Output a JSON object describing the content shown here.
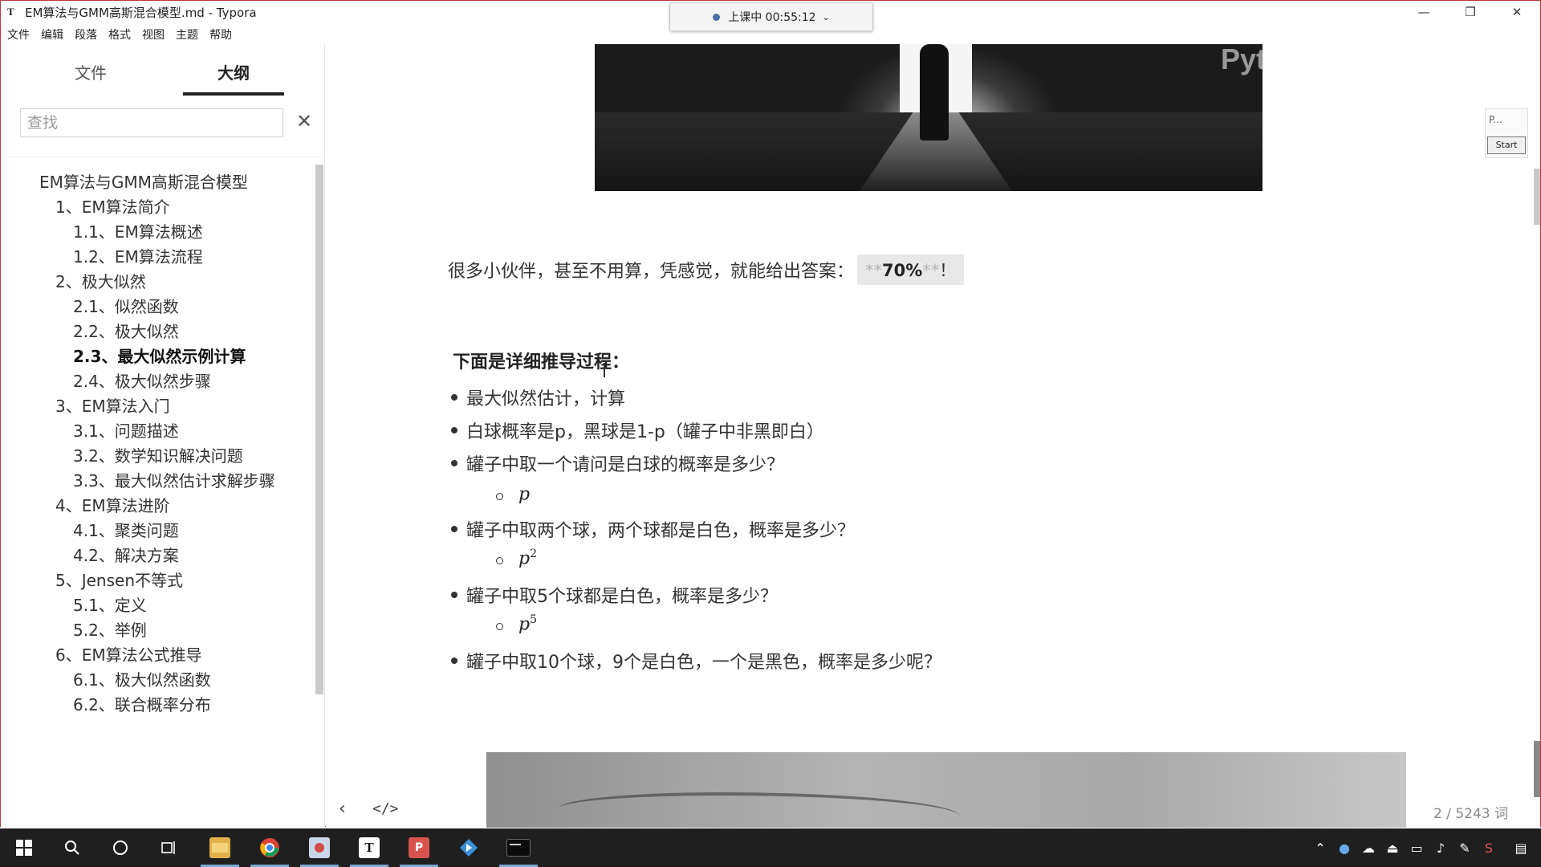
{
  "window": {
    "app_icon": "T",
    "title": "EM算法与GMM高斯混合模型.md - Typora",
    "controls": {
      "minimize": "—",
      "maximize": "❐",
      "close": "✕"
    }
  },
  "timer": {
    "label": "上课中 00:55:12",
    "chevron": "⌄"
  },
  "menu": [
    "文件",
    "编辑",
    "段落",
    "格式",
    "视图",
    "主题",
    "帮助"
  ],
  "sidebar": {
    "tabs": {
      "files": "文件",
      "outline": "大纲"
    },
    "search_placeholder": "查找",
    "close_glyph": "✕",
    "outline": [
      {
        "level": 1,
        "label": "EM算法与GMM高斯混合模型"
      },
      {
        "level": 2,
        "label": "1、EM算法简介"
      },
      {
        "level": 3,
        "label": "1.1、EM算法概述"
      },
      {
        "level": 3,
        "label": "1.2、EM算法流程"
      },
      {
        "level": 2,
        "label": "2、极大似然"
      },
      {
        "level": 3,
        "label": "2.1、似然函数"
      },
      {
        "level": 3,
        "label": "2.2、极大似然"
      },
      {
        "level": 3,
        "label": "2.3、最大似然示例计算",
        "active": true
      },
      {
        "level": 3,
        "label": "2.4、极大似然步骤"
      },
      {
        "level": 2,
        "label": "3、EM算法入门"
      },
      {
        "level": 3,
        "label": "3.1、问题描述"
      },
      {
        "level": 3,
        "label": "3.2、数学知识解决问题"
      },
      {
        "level": 3,
        "label": "3.3、最大似然估计求解步骤"
      },
      {
        "level": 2,
        "label": "4、EM算法进阶"
      },
      {
        "level": 3,
        "label": "4.1、聚类问题"
      },
      {
        "level": 3,
        "label": "4.2、解决方案"
      },
      {
        "level": 2,
        "label": "5、Jensen不等式"
      },
      {
        "level": 3,
        "label": "5.1、定义"
      },
      {
        "level": 3,
        "label": "5.2、举例"
      },
      {
        "level": 2,
        "label": "6、EM算法公式推导"
      },
      {
        "level": 3,
        "label": "6.1、极大似然函数"
      },
      {
        "level": 3,
        "label": "6.2、联合概率分布"
      }
    ]
  },
  "content": {
    "watermark": "Pyt bilibili",
    "paragraph": "很多小伙伴，甚至不用算，凭感觉，就能给出答案：",
    "answer_prefix": "**",
    "answer": "70%",
    "answer_suffix": "**",
    "answer_end": "！",
    "heading": "下面是详细推导过程：",
    "items": [
      {
        "text": "最大似然估计，计算"
      },
      {
        "text": "白球概率是p，黑球是1-p（罐子中非黑即白）"
      },
      {
        "text": "罐子中取一个请问是白球的概率是多少？",
        "sub": "p",
        "sup": ""
      },
      {
        "text": "罐子中取两个球，两个球都是白色，概率是多少？",
        "sub": "p",
        "sup": "2"
      },
      {
        "text": "罐子中取5个球都是白色，概率是多少？",
        "sub": "p",
        "sup": "5"
      },
      {
        "text": "罐子中取10个球，9个是白色，一个是黑色，概率是多少呢？"
      }
    ],
    "footer": {
      "back": "‹",
      "source": "</>",
      "word_count": "2 / 5243 词"
    }
  },
  "ppt_widget": {
    "label": "P...",
    "start": "Start"
  },
  "taskbar": {
    "icons": [
      "windows-start-icon",
      "search-icon",
      "cortana-icon",
      "task-view-icon",
      "file-explorer-icon",
      "chrome-icon",
      "paint-icon",
      "typora-icon",
      "wps-pdf-icon",
      "app-arrow-icon",
      "terminal-icon"
    ]
  }
}
